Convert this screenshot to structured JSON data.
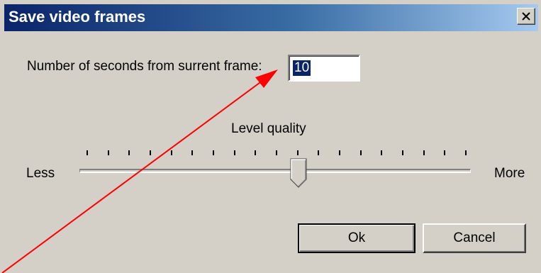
{
  "dialog": {
    "title": "Save video frames"
  },
  "seconds": {
    "label": "Number of seconds from surrent frame:",
    "value": "10"
  },
  "quality": {
    "title": "Level quality",
    "min_label": "Less",
    "max_label": "More",
    "level_fraction": 0.56,
    "tick_count": 19
  },
  "buttons": {
    "ok_label": "Ok",
    "cancel_label": "Cancel"
  },
  "colors": {
    "title_start": "#0a246a",
    "title_end": "#a6caf0",
    "face": "#d4d0c8",
    "selection": "#0a246a",
    "annotation": "#ff0000"
  },
  "icons": {
    "close": "close-icon",
    "arrow": "annotation-arrow-icon"
  }
}
